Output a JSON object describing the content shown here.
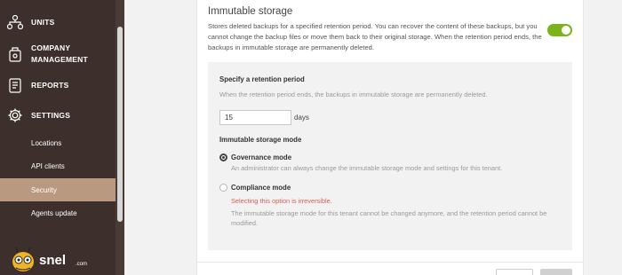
{
  "sidebar": {
    "items": [
      {
        "label": "UNITS",
        "icon": "units-icon"
      },
      {
        "label": "COMPANY MANAGEMENT",
        "icon": "company-management-icon"
      },
      {
        "label": "REPORTS",
        "icon": "reports-icon"
      },
      {
        "label": "SETTINGS",
        "icon": "gear-icon"
      }
    ],
    "settings_subitems": [
      {
        "label": "Locations"
      },
      {
        "label": "API clients"
      },
      {
        "label": "Security",
        "active": true
      },
      {
        "label": "Agents update"
      }
    ],
    "logo": {
      "text": "snel",
      "suffix": ".com"
    }
  },
  "immutable_storage": {
    "title": "Immutable storage",
    "description": "Stores deleted backups for a specified retention period. You can recover the content of these backups, but you cannot change the backup files or move them back to their original storage. When the retention period ends, the backups in immutable storage are permanently deleted.",
    "enabled": true,
    "retention": {
      "heading": "Specify a retention period",
      "hint": "When the retention period ends, the backups in immutable storage are permanently deleted.",
      "value": "15",
      "unit": "days"
    },
    "mode": {
      "heading": "Immutable storage mode",
      "options": [
        {
          "label": "Governance mode",
          "description": "An administrator can always change the immutable storage mode and settings for this tenant.",
          "selected": true
        },
        {
          "label": "Compliance mode",
          "warning": "Selecting this option is irreversible.",
          "description": "The immutable storage mode for this tenant cannot be changed anymore, and the retention period cannot be modified.",
          "selected": false
        }
      ]
    }
  },
  "colors": {
    "sidebar": "#3c2f2c",
    "active": "#b99a80",
    "toggle": "#7bb31a",
    "warning": "#e05a4f"
  }
}
